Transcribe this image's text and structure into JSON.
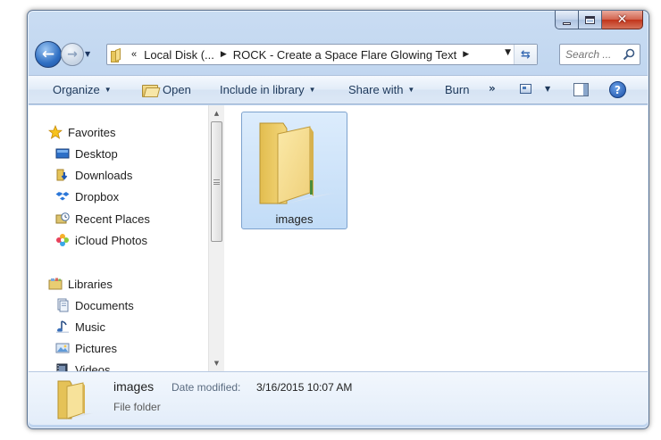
{
  "window": {
    "caption_buttons": {
      "minimize": "minimize-icon",
      "maximize": "maximize-icon",
      "close": "close-icon"
    }
  },
  "navigation": {
    "back_icon": "back-arrow-icon",
    "forward_icon": "forward-arrow-icon",
    "overflow": "«",
    "breadcrumbs": [
      "Local Disk (...",
      "ROCK - Create a Space Flare Glowing Text"
    ],
    "search_placeholder": "Search ..."
  },
  "command_bar": {
    "organize": "Organize",
    "open": "Open",
    "include_in_library": "Include in library",
    "share_with": "Share with",
    "burn": "Burn",
    "more": "»"
  },
  "nav_pane": {
    "favorites_label": "Favorites",
    "favorites": [
      "Desktop",
      "Downloads",
      "Dropbox",
      "Recent Places",
      "iCloud Photos"
    ],
    "libraries_label": "Libraries",
    "libraries": [
      "Documents",
      "Music",
      "Pictures",
      "Videos"
    ]
  },
  "files": [
    {
      "name": "images",
      "type": "folder"
    }
  ],
  "details": {
    "name": "images",
    "modified_label": "Date modified:",
    "modified_value": "3/16/2015 10:07 AM",
    "type": "File folder"
  },
  "colors": {
    "frame": "#c5d9f0",
    "command_bar": "#dce8f6",
    "selection": "#cfe3fa",
    "accent": "#1e395b"
  }
}
